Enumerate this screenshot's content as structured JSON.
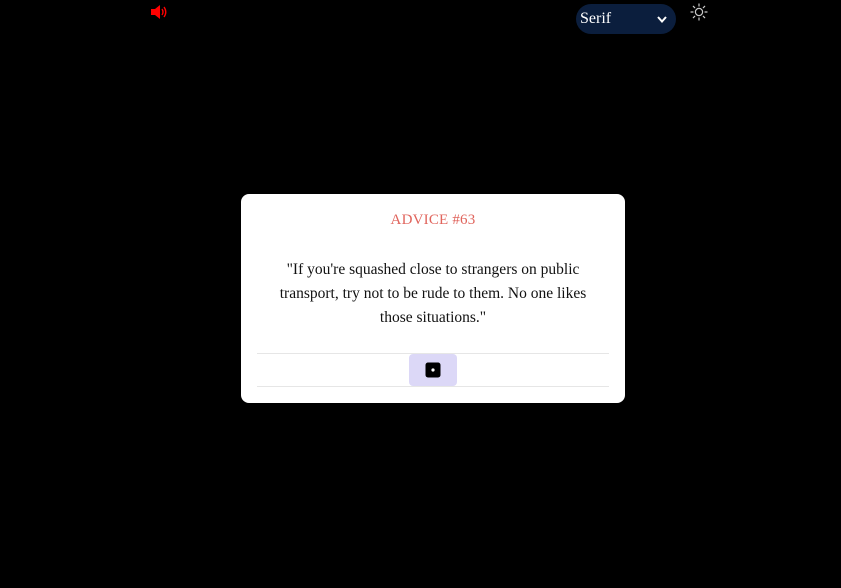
{
  "controls": {
    "sound_icon": "speaker-icon",
    "sound_color": "#ff0000",
    "font_select_value": "Serif",
    "theme_icon": "sun-icon"
  },
  "card": {
    "advice_id": "ADVICE #63",
    "advice_text": "\"If you're squashed close to strangers on public transport, try not to be rude to them. No one likes those situations.\"",
    "dice_icon": "dice-icon",
    "accent_color": "#e0645c",
    "button_color": "#dcd8f7"
  }
}
